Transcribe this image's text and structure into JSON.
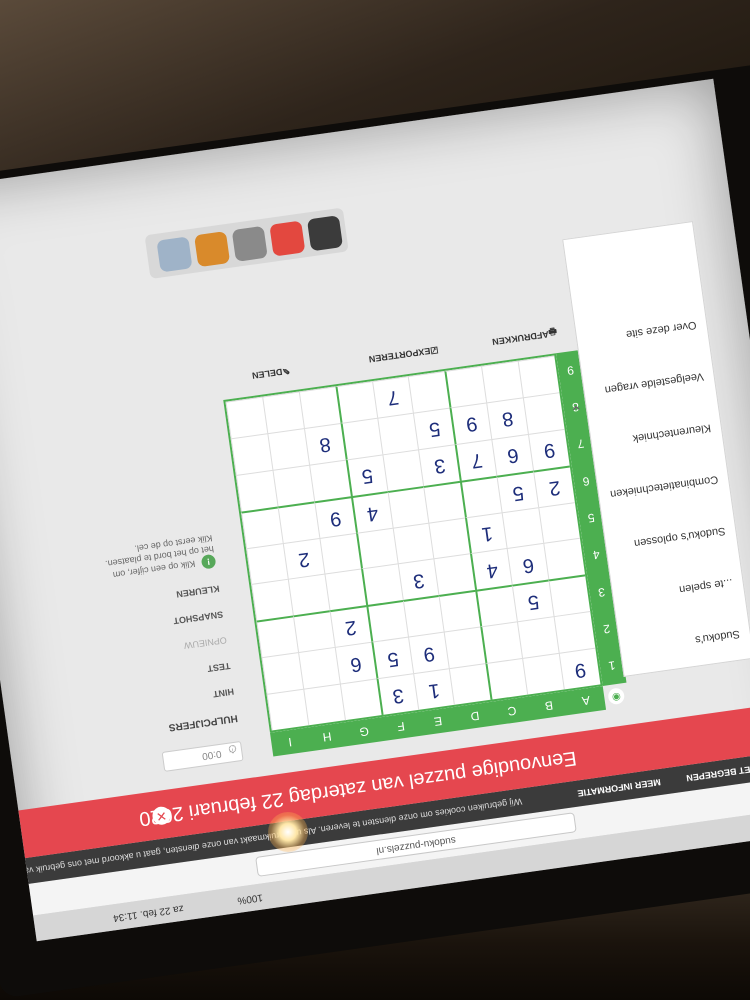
{
  "browser": {
    "url": "sudoku-puzzels.nl",
    "zoom": "100%",
    "clock": "za 22 feb. 11:34"
  },
  "cookie_bar": {
    "text": "Wij gebruiken cookies om onze diensten te leveren. Als u gebruikmaakt van onze diensten, gaat u akkoord met ons gebruik van cookies.",
    "more_info": "MEER INFORMATIE",
    "ok": "IK HEB HET BEGREPEN"
  },
  "banner": {
    "title": "Eenvoudige puzzel van zaterdag 22 februari 2020",
    "close_icon": "close-icon"
  },
  "tools": {
    "timer": "0:00",
    "section_title": "HULPCIJFERS",
    "items": [
      "HINT",
      "TEST",
      "OPNIEUW",
      "SNAPSHOT",
      "KLEUREN"
    ],
    "tip": "Klik op een cijfer, om het op het bord te plaatsen. Klik eerst op de cel."
  },
  "grid": {
    "columns": [
      "A",
      "B",
      "C",
      "D",
      "E",
      "F",
      "G",
      "H",
      "I"
    ],
    "rows": [
      "1",
      "2",
      "3",
      "4",
      "5",
      "6",
      "7",
      "8",
      "9"
    ],
    "cells": [
      [
        "",
        "",
        "",
        "",
        "",
        "",
        "",
        "",
        ""
      ],
      [
        "",
        "",
        "",
        "",
        "",
        "",
        "",
        "",
        ""
      ],
      [
        "",
        "5",
        "",
        "",
        "",
        "",
        "",
        "",
        ""
      ],
      [
        "",
        "",
        "6",
        "",
        "",
        "",
        "",
        "",
        ""
      ],
      [
        "",
        "",
        "",
        "",
        "",
        "",
        "",
        "",
        ""
      ],
      [
        "",
        "",
        "",
        "",
        "",
        "",
        "",
        "",
        ""
      ],
      [
        "",
        "",
        "",
        "",
        "",
        "",
        "",
        "",
        ""
      ],
      [
        "",
        "",
        "",
        "",
        "",
        "",
        "",
        "",
        ""
      ],
      [
        "",
        "",
        "",
        "",
        "",
        "",
        "",
        "",
        ""
      ]
    ],
    "givens": [
      {
        "r": 0,
        "c": 0,
        "v": "9"
      },
      {
        "r": 0,
        "c": 4,
        "v": "1"
      },
      {
        "r": 0,
        "c": 5,
        "v": "3"
      },
      {
        "r": 1,
        "c": 4,
        "v": "9"
      },
      {
        "r": 1,
        "c": 5,
        "v": "5"
      },
      {
        "r": 1,
        "c": 6,
        "v": "6"
      },
      {
        "r": 2,
        "c": 1,
        "v": "5"
      },
      {
        "r": 2,
        "c": 6,
        "v": "2"
      },
      {
        "r": 3,
        "c": 1,
        "v": "6"
      },
      {
        "r": 3,
        "c": 2,
        "v": "4"
      },
      {
        "r": 3,
        "c": 4,
        "v": "3"
      },
      {
        "r": 4,
        "c": 2,
        "v": "1"
      },
      {
        "r": 4,
        "c": 7,
        "v": "2"
      },
      {
        "r": 5,
        "c": 0,
        "v": "2"
      },
      {
        "r": 5,
        "c": 1,
        "v": "5"
      },
      {
        "r": 5,
        "c": 5,
        "v": "4"
      },
      {
        "r": 5,
        "c": 6,
        "v": "9"
      },
      {
        "r": 6,
        "c": 0,
        "v": "9"
      },
      {
        "r": 6,
        "c": 1,
        "v": "6"
      },
      {
        "r": 6,
        "c": 2,
        "v": "7"
      },
      {
        "r": 6,
        "c": 3,
        "v": "3"
      },
      {
        "r": 6,
        "c": 5,
        "v": "5"
      },
      {
        "r": 7,
        "c": 1,
        "v": "8"
      },
      {
        "r": 7,
        "c": 2,
        "v": "9"
      },
      {
        "r": 7,
        "c": 3,
        "v": "5"
      },
      {
        "r": 7,
        "c": 6,
        "v": "8"
      },
      {
        "r": 8,
        "c": 4,
        "v": "7"
      }
    ]
  },
  "actions": {
    "print": "AFDRUKKEN",
    "export": "EXPORTEREN",
    "share": "DELEN"
  },
  "side_menu": {
    "items": [
      "Sudoku's",
      "...te spelen",
      "Sudoku's oplossen",
      "Combinatietechnieken",
      "Kleurentechniek",
      "Veelgestelde vragen",
      "Over deze site"
    ]
  }
}
